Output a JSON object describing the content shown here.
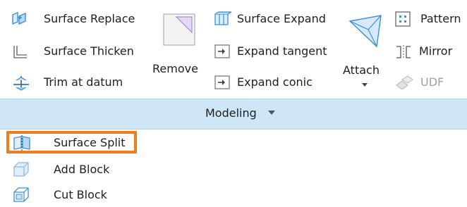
{
  "ribbon": {
    "col1": {
      "surface_replace": "Surface Replace",
      "surface_thicken": "Surface Thicken",
      "trim_at_datum": "Trim at datum"
    },
    "remove_label": "Remove",
    "col3": {
      "surface_expand": "Surface Expand",
      "expand_tangent": "Expand tangent",
      "expand_conic": "Expand conic"
    },
    "attach_label": "Attach",
    "col5": {
      "pattern": "Pattern",
      "mirror": "Mirror",
      "udf": "UDF"
    },
    "group_title": "Modeling"
  },
  "menu": {
    "items": [
      {
        "label": "Surface Split",
        "icon": "surface-split-icon",
        "highlighted": true
      },
      {
        "label": "Add Block",
        "icon": "add-block-icon"
      },
      {
        "label": "Cut Block",
        "icon": "cut-block-icon"
      }
    ]
  },
  "colors": {
    "group_bar": "#cfe6f7",
    "highlight": "#f07c1e",
    "icon_blue": "#3c8fd8",
    "disabled_text": "#a0a0a0"
  }
}
